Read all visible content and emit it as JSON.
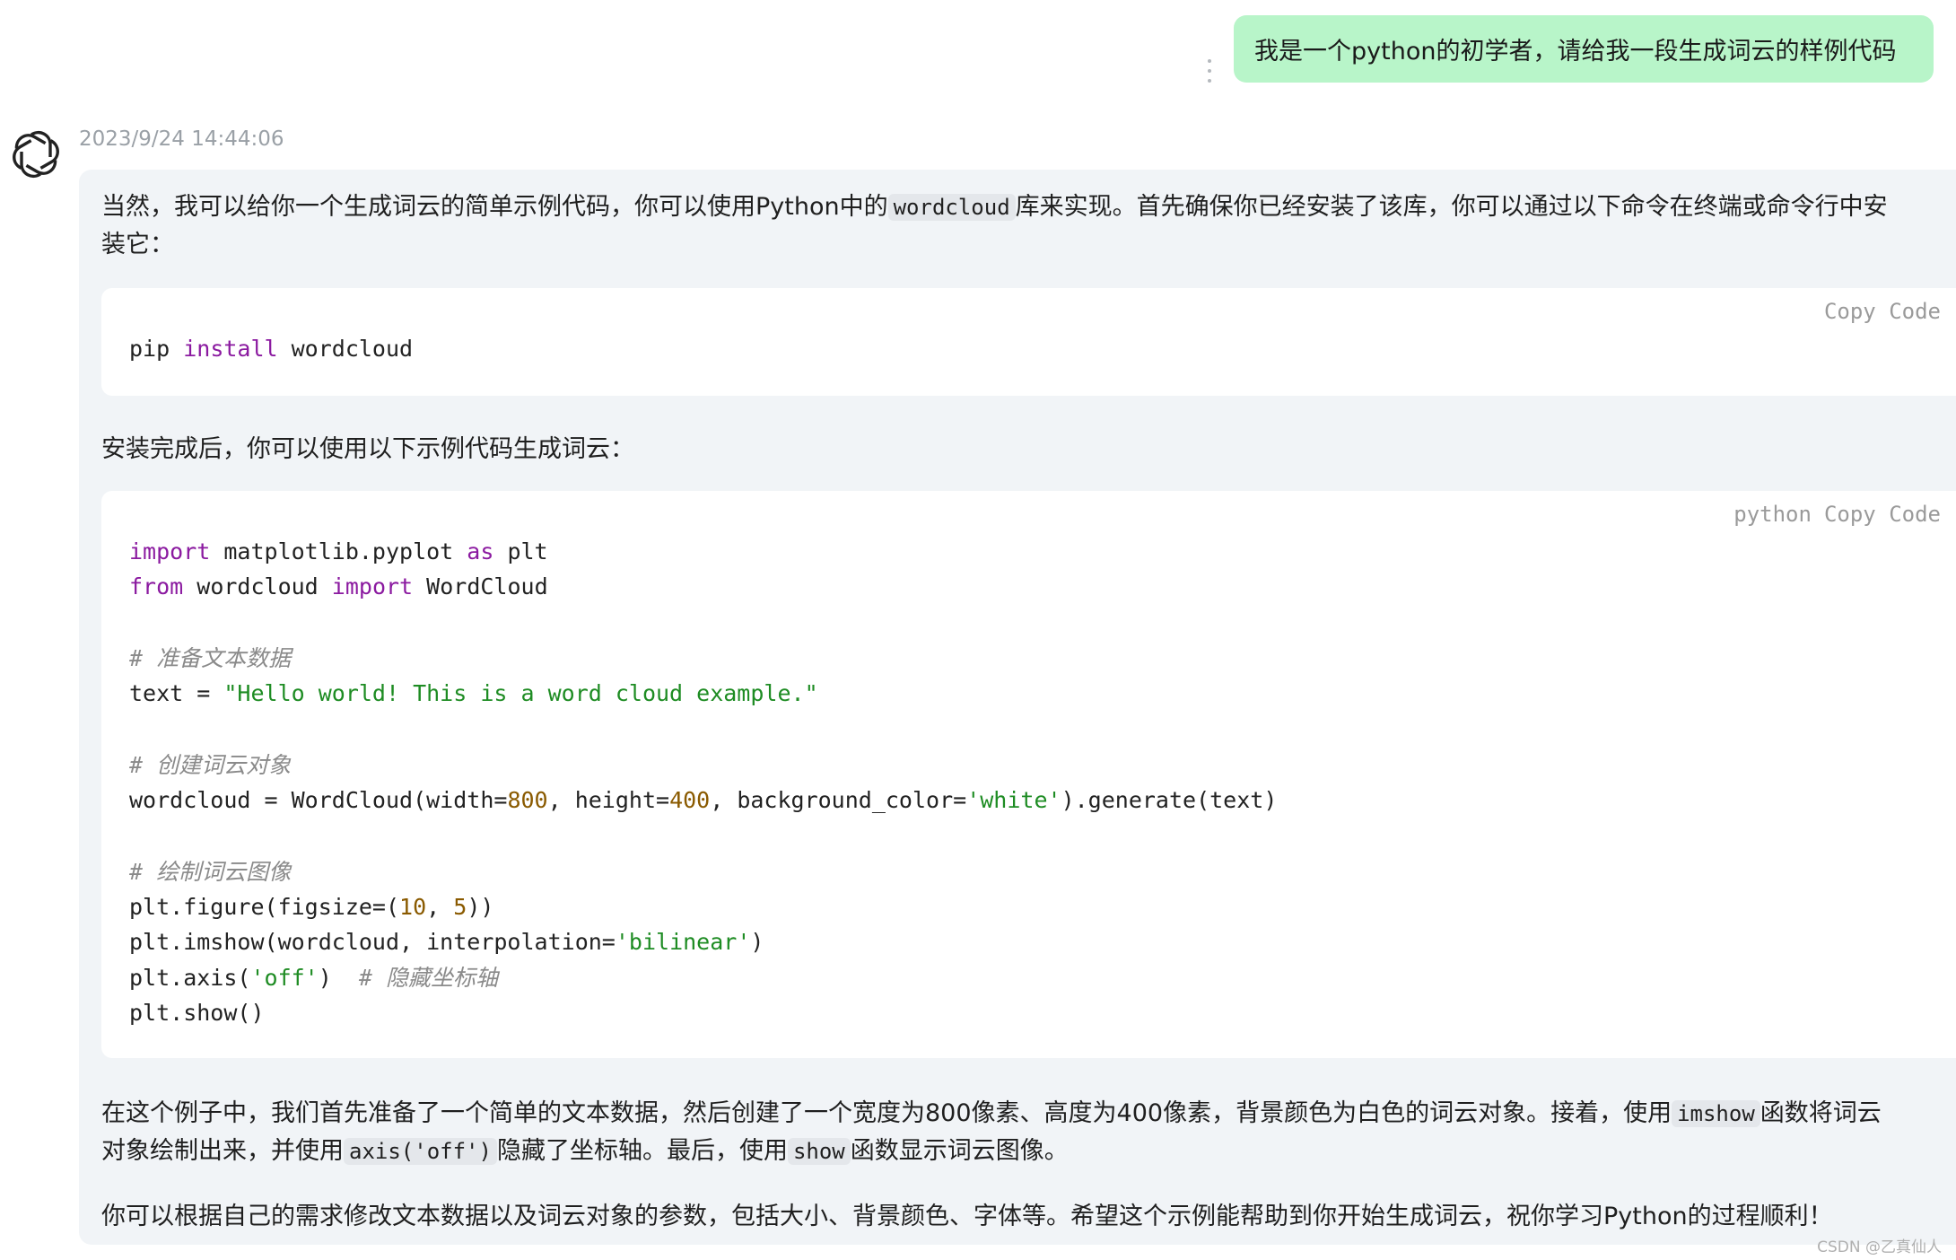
{
  "user_message": "我是一个python的初学者，请给我一段生成词云的样例代码",
  "assistant": {
    "timestamp": "2023/9/24 14:44:06",
    "intro": {
      "line1_a": "当然，我可以给你一个生成词云的简单示例代码，你可以使用Python中的",
      "line1_code": "wordcloud",
      "line1_b": "库来实现。首先确保你已经安装了该库，你可以通过以下命令在终端或命令行中安",
      "line2": "装它："
    },
    "code1": {
      "copy_label": "Copy Code",
      "line_plain1": "pip ",
      "line_kw": "install",
      "line_plain2": " wordcloud"
    },
    "after_install": "安装完成后，你可以使用以下示例代码生成词云：",
    "code2": {
      "lang": "python",
      "copy_label": "Copy Code",
      "l1_kw1": "import",
      "l1_a": " matplotlib.pyplot ",
      "l1_kw2": "as",
      "l1_b": " plt",
      "l2_kw1": "from",
      "l2_a": " wordcloud ",
      "l2_kw2": "import",
      "l2_b": " WordCloud",
      "c1": "# 准备文本数据",
      "l4_a": "text = ",
      "l4_str": "\"Hello world! This is a word cloud example.\"",
      "c2": "# 创建词云对象",
      "l6_a": "wordcloud = WordCloud(width=",
      "l6_n1": "800",
      "l6_b": ", height=",
      "l6_n2": "400",
      "l6_c": ", background_color=",
      "l6_str": "'white'",
      "l6_d": ").generate(text)",
      "c3": "# 绘制词云图像",
      "l8_a": "plt.figure(figsize=(",
      "l8_n1": "10",
      "l8_b": ", ",
      "l8_n2": "5",
      "l8_c": "))",
      "l9_a": "plt.imshow(wordcloud, interpolation=",
      "l9_str": "'bilinear'",
      "l9_b": ")",
      "l10_a": "plt.axis(",
      "l10_str": "'off'",
      "l10_b": ")  ",
      "l10_cm": "# 隐藏坐标轴",
      "l11": "plt.show()"
    },
    "explain": {
      "line1_a": "在这个例子中，我们首先准备了一个简单的文本数据，然后创建了一个宽度为800像素、高度为400像素，背景颜色为白色的词云对象。接着，使用",
      "line1_code": "imshow",
      "line1_b": "函数将词云",
      "line2_a": "对象绘制出来，并使用",
      "line2_code1": "axis('off')",
      "line2_b": "隐藏了坐标轴。最后，使用",
      "line2_code2": "show",
      "line2_c": "函数显示词云图像。"
    },
    "closing": "你可以根据自己的需求修改文本数据以及词云对象的参数，包括大小、背景颜色、字体等。希望这个示例能帮助到你开始生成词云，祝你学习Python的过程顺利！"
  },
  "watermark": "CSDN @乙真仙人",
  "icons": {
    "more": "more-vertical-icon",
    "avatar": "openai-logo-icon"
  },
  "colors": {
    "user_bubble": "#b8f5c9",
    "reply_bg": "#f1f4f7",
    "keyword": "#8b1aa0",
    "string": "#1e8c23",
    "number": "#8a5a00"
  }
}
